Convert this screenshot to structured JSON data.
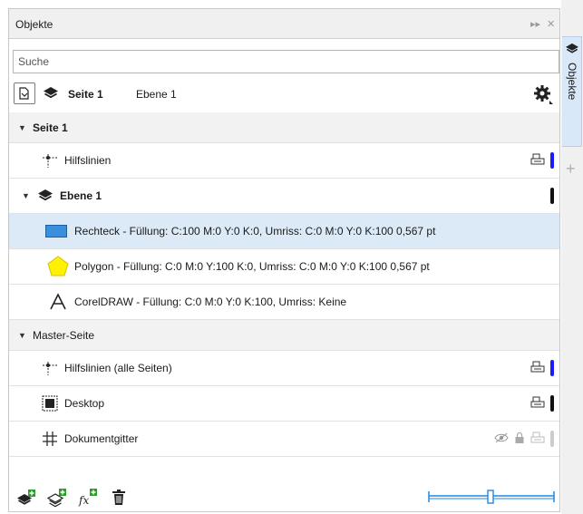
{
  "titlebar": {
    "title": "Objekte",
    "pin_glyph": "▸▸",
    "close_glyph": "✕"
  },
  "search": {
    "placeholder": "Suche",
    "value": ""
  },
  "toolbar": {
    "current_page": "Seite 1",
    "current_layer": "Ebene 1"
  },
  "tree": {
    "page_section": "Seite 1",
    "guides": "Hilfslinien",
    "layer": "Ebene 1",
    "objects": [
      "Rechteck - Füllung: C:100 M:0 Y:0 K:0, Umriss: C:0 M:0 Y:0 K:100  0,567 pt",
      "Polygon - Füllung: C:0 M:0 Y:100 K:0, Umriss: C:0 M:0 Y:0 K:100  0,567 pt",
      "CorelDRAW - Füllung: C:0 M:0 Y:0 K:100, Umriss: Keine"
    ],
    "master_section": "Master-Seite",
    "master_items": [
      "Hilfslinien (alle Seiten)",
      "Desktop",
      "Dokumentgitter"
    ]
  },
  "side_tab": {
    "label": "Objekte"
  },
  "colors": {
    "guides_bar": "#1a1aff",
    "black_bar": "#111111",
    "grid_bar": "#cccccc",
    "rect_fill": "#3c8fdd",
    "polygon_fill": "#fff200",
    "selected_row": "#dceaf8",
    "slider": "#1e88e5"
  },
  "icons": [
    "page-icon",
    "layer-stack-icon",
    "gear-icon",
    "guides-icon",
    "printer-icon",
    "rectangle-icon",
    "pentagon-icon",
    "text-icon",
    "desktop-icon",
    "grid-icon",
    "eye-icon",
    "lock-icon",
    "new-layer-icon",
    "new-master-layer-icon",
    "new-effect-layer-icon",
    "trash-icon",
    "zoom-slider"
  ]
}
